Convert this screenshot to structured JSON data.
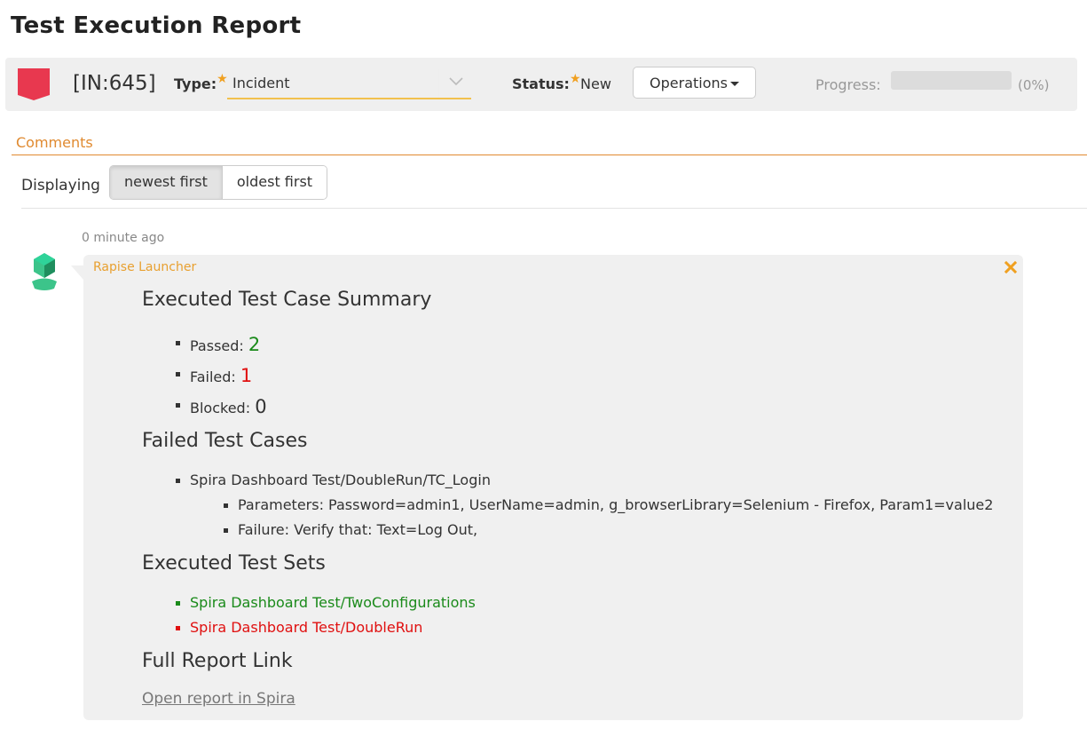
{
  "page": {
    "title": "Test Execution Report"
  },
  "toolbar": {
    "incident_id": "[IN:645]",
    "type_label": "Type:",
    "type_value": "Incident",
    "status_label": "Status:",
    "status_value": "New",
    "operations_label": "Operations",
    "progress_label": "Progress:",
    "progress_percent": "(0%)",
    "progress_value": 0,
    "required_mark": "★",
    "flag_color": "#e8384f"
  },
  "comments": {
    "tab_label": "Comments",
    "displaying_label": "Displaying",
    "sort_options": [
      "newest first",
      "oldest first"
    ],
    "sort_selected": "newest first"
  },
  "comment": {
    "time": "0 minute ago",
    "author": "Rapise Launcher",
    "summary_heading": "Executed Test Case Summary",
    "summary": [
      {
        "label": "Passed:",
        "value": "2",
        "color": "#1a8a1a"
      },
      {
        "label": "Failed:",
        "value": "1",
        "color": "#e01010"
      },
      {
        "label": "Blocked:",
        "value": "0",
        "color": "#333333"
      }
    ],
    "failed_heading": "Failed Test Cases",
    "failed_case": "Spira Dashboard Test/DoubleRun/TC_Login",
    "failed_details": [
      "Parameters: Password=admin1, UserName=admin, g_browserLibrary=Selenium - Firefox, Param1=value2",
      "Failure: Verify that: Text=Log Out,"
    ],
    "sets_heading": "Executed Test Sets",
    "sets": [
      {
        "name": "Spira Dashboard Test/TwoConfigurations",
        "color": "#1a8a1a"
      },
      {
        "name": "Spira Dashboard Test/DoubleRun",
        "color": "#e01010"
      }
    ],
    "report_heading": "Full Report Link",
    "report_link": "Open report in Spira"
  }
}
